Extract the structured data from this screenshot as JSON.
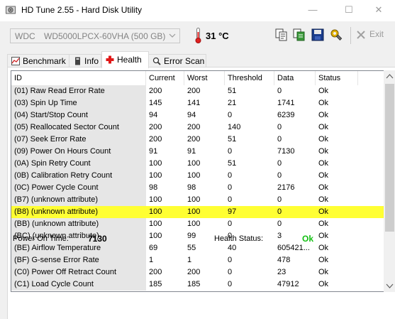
{
  "window": {
    "title": "HD Tune 2.55 - Hard Disk Utility",
    "minimize": "—",
    "maximize": "☐",
    "close": "✕"
  },
  "toolbar": {
    "drive_prefix": "WDC",
    "drive_model": "WD5000LPCX-60VHA (500 GB)",
    "temperature": "31 °C",
    "exit_label": "Exit"
  },
  "tabs": [
    {
      "label": "Benchmark",
      "icon": "benchmark-icon"
    },
    {
      "label": "Info",
      "icon": "info-icon"
    },
    {
      "label": "Health",
      "icon": "health-cross-icon",
      "active": true
    },
    {
      "label": "Error Scan",
      "icon": "error-scan-icon"
    }
  ],
  "table": {
    "headers": [
      "ID",
      "Current",
      "Worst",
      "Threshold",
      "Data",
      "Status"
    ],
    "rows": [
      {
        "id": "(01) Raw Read Error Rate",
        "current": "200",
        "worst": "200",
        "threshold": "51",
        "data": "0",
        "status": "Ok"
      },
      {
        "id": "(03) Spin Up Time",
        "current": "145",
        "worst": "141",
        "threshold": "21",
        "data": "1741",
        "status": "Ok"
      },
      {
        "id": "(04) Start/Stop Count",
        "current": "94",
        "worst": "94",
        "threshold": "0",
        "data": "6239",
        "status": "Ok"
      },
      {
        "id": "(05) Reallocated Sector Count",
        "current": "200",
        "worst": "200",
        "threshold": "140",
        "data": "0",
        "status": "Ok"
      },
      {
        "id": "(07) Seek Error Rate",
        "current": "200",
        "worst": "200",
        "threshold": "51",
        "data": "0",
        "status": "Ok"
      },
      {
        "id": "(09) Power On Hours Count",
        "current": "91",
        "worst": "91",
        "threshold": "0",
        "data": "7130",
        "status": "Ok"
      },
      {
        "id": "(0A) Spin Retry Count",
        "current": "100",
        "worst": "100",
        "threshold": "51",
        "data": "0",
        "status": "Ok"
      },
      {
        "id": "(0B) Calibration Retry Count",
        "current": "100",
        "worst": "100",
        "threshold": "0",
        "data": "0",
        "status": "Ok"
      },
      {
        "id": "(0C) Power Cycle Count",
        "current": "98",
        "worst": "98",
        "threshold": "0",
        "data": "2176",
        "status": "Ok"
      },
      {
        "id": "(B7) (unknown attribute)",
        "current": "100",
        "worst": "100",
        "threshold": "0",
        "data": "0",
        "status": "Ok"
      },
      {
        "id": "(B8) (unknown attribute)",
        "current": "100",
        "worst": "100",
        "threshold": "97",
        "data": "0",
        "status": "Ok",
        "highlight": true
      },
      {
        "id": "(BB) (unknown attribute)",
        "current": "100",
        "worst": "100",
        "threshold": "0",
        "data": "0",
        "status": "Ok"
      },
      {
        "id": "(BC) (unknown attribute)",
        "current": "100",
        "worst": "99",
        "threshold": "0",
        "data": "3",
        "status": "Ok"
      },
      {
        "id": "(BE) Airflow Temperature",
        "current": "69",
        "worst": "55",
        "threshold": "40",
        "data": "605421...",
        "status": "Ok"
      },
      {
        "id": "(BF) G-sense Error Rate",
        "current": "1",
        "worst": "1",
        "threshold": "0",
        "data": "478",
        "status": "Ok"
      },
      {
        "id": "(C0) Power Off Retract Count",
        "current": "200",
        "worst": "200",
        "threshold": "0",
        "data": "23",
        "status": "Ok"
      },
      {
        "id": "(C1) Load Cycle Count",
        "current": "185",
        "worst": "185",
        "threshold": "0",
        "data": "47912",
        "status": "Ok"
      }
    ]
  },
  "status": {
    "power_on_label": "Power On Time:",
    "power_on_value": "7130",
    "health_label": "Health Status:",
    "health_value": "Ok"
  },
  "colors": {
    "highlight": "#ffff33",
    "health_ok": "#12c012",
    "id_column_bg": "#e6e6e6"
  }
}
